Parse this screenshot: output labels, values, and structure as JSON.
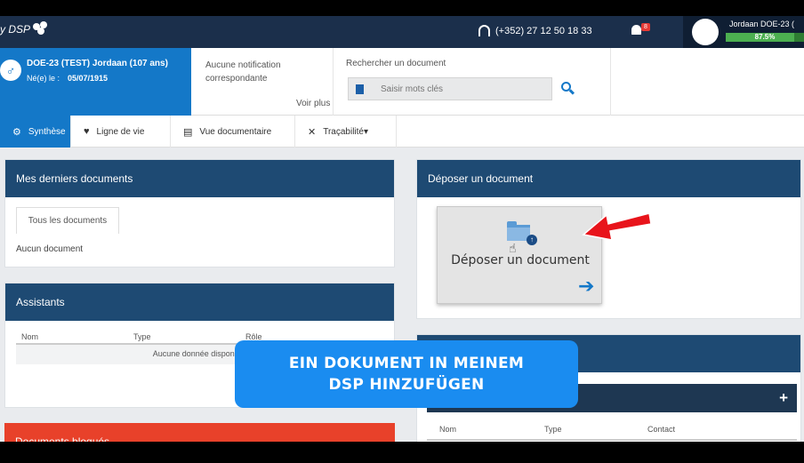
{
  "header": {
    "logo_text": "y DSP",
    "phone": "(+352) 27 12 50 18 33",
    "notifications_count": "8",
    "user_name": "Jordaan DOE-23 (",
    "user_progress_label": "87.5%",
    "user_progress": 87.5
  },
  "patient": {
    "gender_symbol": "♂",
    "name": "DOE-23 (TEST) Jordaan (107 ans)",
    "dob_label": "Né(e) le :",
    "dob": "05/07/1915"
  },
  "notifications": {
    "text": "Aucune notification correspondante",
    "more": "Voir plus"
  },
  "search": {
    "label": "Rechercher un document",
    "placeholder": "Saisir mots clés"
  },
  "tabs": [
    {
      "label": "Synthèse",
      "icon": "gear-icon",
      "glyph": "⚙"
    },
    {
      "label": "Ligne de vie",
      "icon": "heart-pulse-icon",
      "glyph": "♥"
    },
    {
      "label": "Vue documentaire",
      "icon": "documents-icon",
      "glyph": "▤"
    },
    {
      "label": "Traçabilité▾",
      "icon": "tools-icon",
      "glyph": "✕"
    }
  ],
  "recent_docs": {
    "title": "Mes derniers documents",
    "tab_all": "Tous les documents",
    "empty": "Aucun document"
  },
  "assistants": {
    "title": "Assistants",
    "columns": [
      "Nom",
      "Type",
      "Rôle"
    ],
    "empty": "Aucune donnée disponible da"
  },
  "blocked_docs": {
    "title": "Documents bloqués"
  },
  "upload": {
    "title": "Déposer un document",
    "card_label": "Déposer un document",
    "arrow_glyph": "➔"
  },
  "contacts": {
    "add_glyph": "+",
    "columns": [
      "Nom",
      "Type",
      "Contact"
    ]
  },
  "caption": {
    "line1": "EIN DOKUMENT IN MEINEM",
    "line2": "DSP HINZUFÜGEN"
  },
  "colors": {
    "header": "#1b2f4b",
    "accent": "#1478c8",
    "panel_head": "#1e4a73",
    "alert": "#e8412a",
    "caption": "#1a8cf0"
  }
}
